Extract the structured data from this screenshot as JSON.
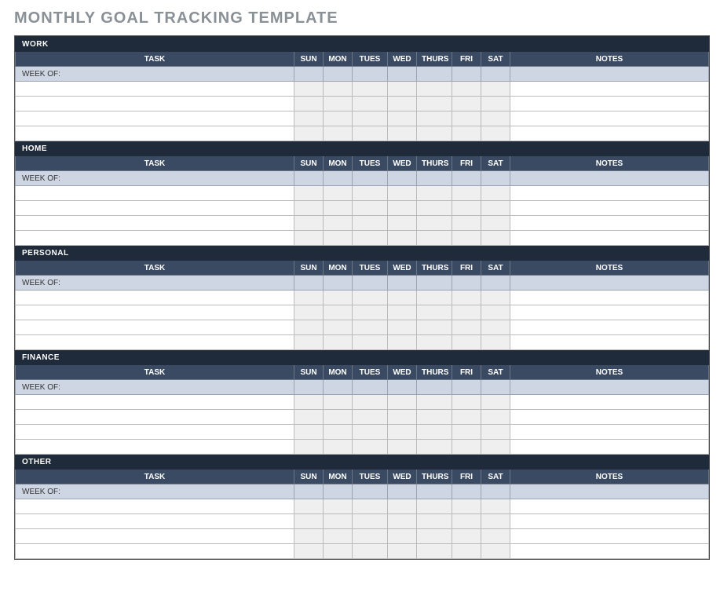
{
  "title": "MONTHLY GOAL TRACKING TEMPLATE",
  "columns": {
    "task": "TASK",
    "days": [
      "SUN",
      "MON",
      "TUES",
      "WED",
      "THURS",
      "FRI",
      "SAT"
    ],
    "notes": "NOTES"
  },
  "week_label": "WEEK OF:",
  "sections": [
    {
      "name": "WORK",
      "rows": [
        "",
        "",
        "",
        ""
      ]
    },
    {
      "name": "HOME",
      "rows": [
        "",
        "",
        "",
        ""
      ]
    },
    {
      "name": "PERSONAL",
      "rows": [
        "",
        "",
        "",
        ""
      ]
    },
    {
      "name": "FINANCE",
      "rows": [
        "",
        "",
        "",
        ""
      ]
    },
    {
      "name": "OTHER",
      "rows": [
        "",
        "",
        "",
        ""
      ]
    }
  ]
}
